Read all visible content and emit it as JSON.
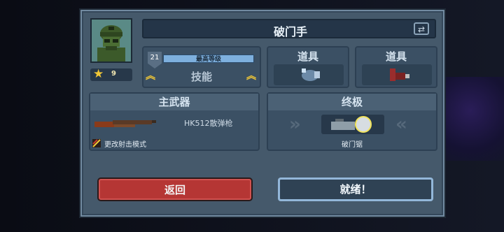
{
  "hero": {
    "name": "破门手",
    "avatar_icon": "soldier-portrait-icon",
    "star_count": "9",
    "level": "21",
    "level_status": "最高等级",
    "skills_label": "技能"
  },
  "items": [
    {
      "label": "道具",
      "icon": "grenade-icon"
    },
    {
      "label": "道具",
      "icon": "ammo-icon"
    }
  ],
  "primary_weapon": {
    "header": "主武器",
    "name": "HK512散弹枪",
    "fire_mode": "更改射击模式",
    "icon": "shotgun-icon"
  },
  "ultimate": {
    "header": "终极",
    "name": "破门锯",
    "icon": "breach-saw-icon"
  },
  "buttons": {
    "back": "返回",
    "ready": "就绪！"
  },
  "colors": {
    "panel": "#45596b",
    "back_button": "#b53634",
    "ready_border": "#93b7d9",
    "accent_gold": "#f1c736"
  }
}
